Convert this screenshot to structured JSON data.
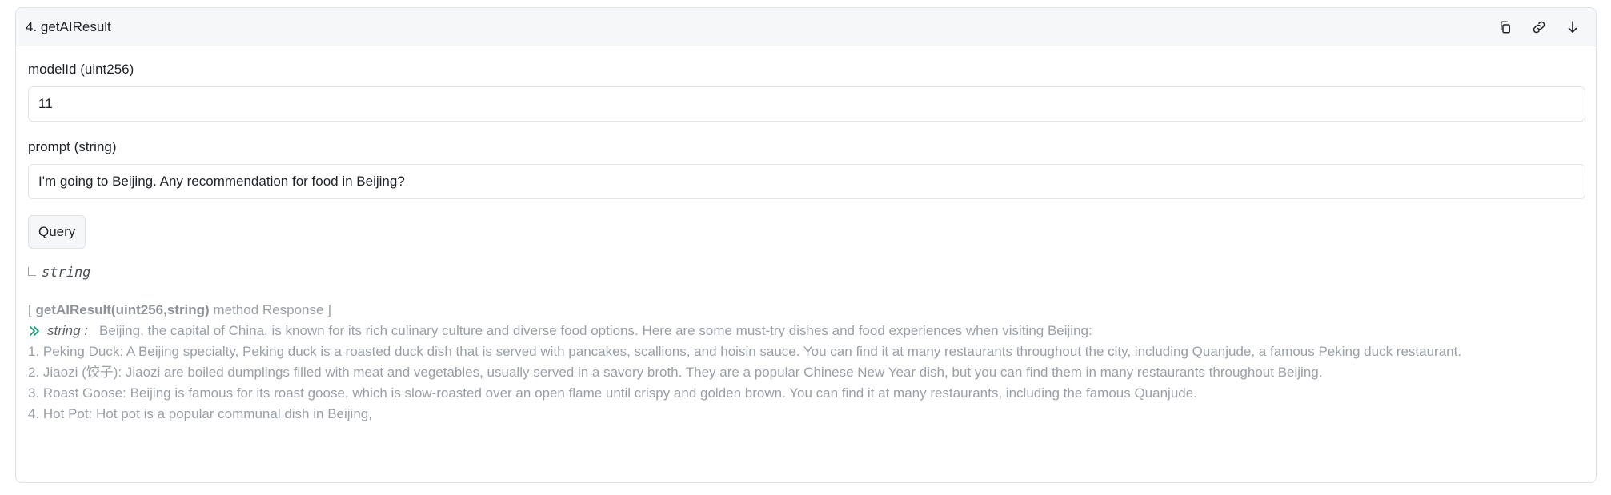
{
  "method": {
    "title": "4. getAIResult"
  },
  "header_icons": [
    "copy-icon",
    "link-icon",
    "arrow-down-icon"
  ],
  "inputs": {
    "model_label": "modelId (uint256)",
    "model_value": "11",
    "prompt_label": "prompt (string)",
    "prompt_value": "I'm going to Beijing. Any recommendation for food in Beijing?"
  },
  "query_button": "Query",
  "returns_type": "string",
  "response": {
    "open_bracket": "[",
    "signature": "getAIResult(uint256,string)",
    "suffix": "method Response ]",
    "key": "string :",
    "lines": [
      "Beijing, the capital of China, is known for its rich culinary culture and diverse food options. Here are some must-try dishes and food experiences when visiting Beijing:",
      "1. Peking Duck: A Beijing specialty, Peking duck is a roasted duck dish that is served with pancakes, scallions, and hoisin sauce. You can find it at many restaurants throughout the city, including Quanjude, a famous Peking duck restaurant.",
      "2. Jiaozi (饺子): Jiaozi are boiled dumplings filled with meat and vegetables, usually served in a savory broth. They are a popular Chinese New Year dish, but you can find them in many restaurants throughout Beijing.",
      "3. Roast Goose: Beijing is famous for its roast goose, which is slow-roasted over an open flame until crispy and golden brown. You can find it at many restaurants, including the famous Quanjude.",
      "4. Hot Pot: Hot pot is a popular communal dish in Beijing,"
    ]
  },
  "colors": {
    "accent": "#0f9d76",
    "muted_text": "#9aa0a6",
    "header_bg": "#f6f7f9",
    "border": "#dfe1e5"
  }
}
